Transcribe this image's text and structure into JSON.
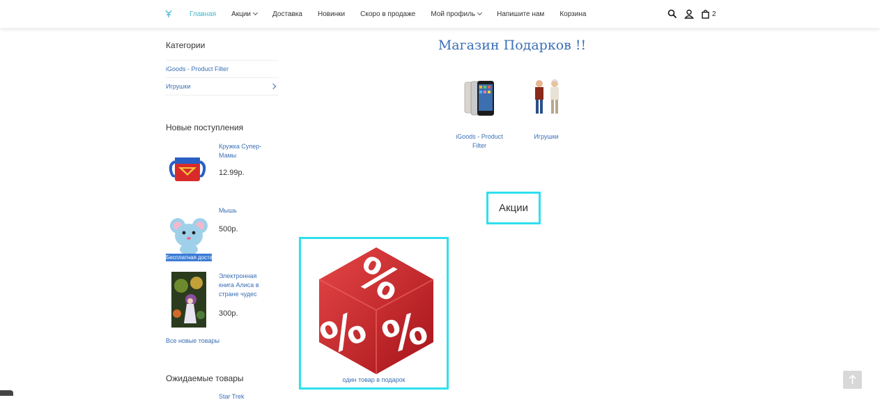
{
  "header": {
    "nav": [
      {
        "label": "Главная",
        "active": true,
        "dropdown": false
      },
      {
        "label": "Акции",
        "active": false,
        "dropdown": true
      },
      {
        "label": "Доставка",
        "active": false,
        "dropdown": false
      },
      {
        "label": "Новинки",
        "active": false,
        "dropdown": false
      },
      {
        "label": "Скоро в продаже",
        "active": false,
        "dropdown": false
      },
      {
        "label": "Мой профиль",
        "active": false,
        "dropdown": true
      },
      {
        "label": "Напишите нам",
        "active": false,
        "dropdown": false
      },
      {
        "label": "Корзина",
        "active": false,
        "dropdown": false
      }
    ],
    "icons": [
      "search-icon",
      "user-icon",
      "cart-icon"
    ],
    "cart_count": "2",
    "accent_color": "#3fb6c8"
  },
  "sidebar": {
    "categories_title": "Категории",
    "categories": [
      {
        "label": "iGoods - Product Filter",
        "has_children": false
      },
      {
        "label": "Игрушки",
        "has_children": true
      }
    ],
    "new_title": "Новые поступления",
    "new_products": [
      {
        "name": "Кружка Супер-Мамы",
        "price": "12.99р.",
        "icon": "mug-image"
      },
      {
        "name": "Мышь",
        "price": "500р.",
        "icon": "mouse-toy-image",
        "badge": "Бесплатная доставка"
      },
      {
        "name": "Электронная книга Алиса в стране чудес",
        "price": "300р.",
        "icon": "book-cover-image"
      }
    ],
    "all_new_link": "Все новые товары",
    "expected_title": "Ожидаемые товары",
    "expected_cut": "Star Trek"
  },
  "main": {
    "title": "Магазин Подарков !!",
    "categories": [
      {
        "label": "iGoods - Product Filter",
        "icon": "iphone-image"
      },
      {
        "label": "Игрушки",
        "icon": "toy-figures-image"
      }
    ],
    "promo_heading": "Акции",
    "promo_item": {
      "label": "один товар в подарок",
      "icon": "percent-dice-image"
    },
    "highlight_color": "#2ee0ee"
  }
}
